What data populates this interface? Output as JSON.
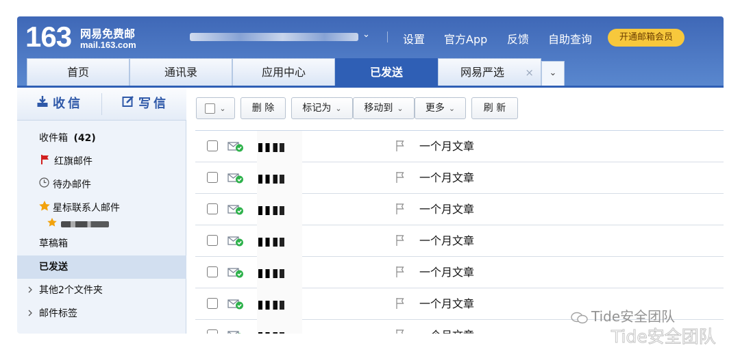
{
  "header": {
    "logo_number": "163",
    "logo_cn": "网易免费邮",
    "logo_domain": "mail.163.com",
    "account_chevron": "⌄",
    "links": [
      "设置",
      "官方App",
      "反馈",
      "自助查询"
    ],
    "vip_button": "开通邮箱会员"
  },
  "tabs": [
    {
      "label": "首页",
      "active": false
    },
    {
      "label": "通讯录",
      "active": false
    },
    {
      "label": "应用中心",
      "active": false
    },
    {
      "label": "已发送",
      "active": true
    },
    {
      "label": "网易严选",
      "active": false,
      "closable": true
    }
  ],
  "tab_close": "×",
  "tab_more": "⌄",
  "sidebar": {
    "receive_label": "收信",
    "write_label": "写信",
    "folders": [
      {
        "label": "收件箱",
        "count": "(42)",
        "icon": "inbox"
      },
      {
        "label": "红旗邮件",
        "icon": "red-flag-icon"
      },
      {
        "label": "待办邮件",
        "icon": "clock-icon"
      },
      {
        "label": "星标联系人邮件",
        "icon": "star-icon"
      },
      {
        "label": "",
        "icon": "star-icon"
      },
      {
        "label": "草稿箱",
        "icon": ""
      },
      {
        "label": "已发送",
        "icon": "",
        "selected": true
      },
      {
        "label": "其他2个文件夹",
        "icon": "chevron-right-icon"
      },
      {
        "label": "邮件标签",
        "icon": "chevron-right-icon"
      }
    ]
  },
  "toolbar": {
    "delete": "删 除",
    "mark_as": "标记为",
    "move_to": "移动到",
    "more": "更多",
    "refresh": "刷 新",
    "caret": "⌄"
  },
  "emails": [
    {
      "subject": "一个月文章"
    },
    {
      "subject": "一个月文章"
    },
    {
      "subject": "一个月文章"
    },
    {
      "subject": "一个月文章"
    },
    {
      "subject": "一个月文章"
    },
    {
      "subject": "一个月文章"
    },
    {
      "subject": "一个月文章"
    }
  ],
  "watermark": "Tide安全团队",
  "colors": {
    "header_blue": "#3f68b7",
    "active_tab": "#2f5fb5",
    "vip_yellow": "#f7c83c",
    "sent_check": "#2fb24c",
    "flag_red": "#d11f1f",
    "star_orange": "#f2a20c"
  }
}
